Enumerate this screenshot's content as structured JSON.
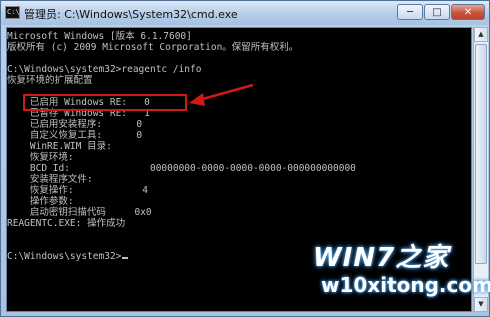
{
  "window": {
    "title": "管理员: C:\\Windows\\System32\\cmd.exe",
    "icon_text": "C:\\",
    "controls": {
      "minimize": "─",
      "maximize": "□",
      "close": "✕"
    }
  },
  "console": {
    "lines": [
      "Microsoft Windows [版本 6.1.7600]",
      "版权所有 (c) 2009 Microsoft Corporation。保留所有权利。",
      "",
      "C:\\Windows\\system32>reagentc /info",
      "恢复环境的扩展配置",
      "",
      "    已启用 Windows RE:   0",
      "    已暂存 Windows RE:   1",
      "    已启用安装程序:      0",
      "    自定义恢复工具:      0",
      "    WinRE.WIM 目录:",
      "    恢复环境:",
      "    BCD Id:              00000000-0000-0000-0000-000000000000",
      "    安装程序文件:",
      "    恢复操作:            4",
      "    操作参数:",
      "    启动密钥扫描代码     0x0",
      "REAGENTC.EXE: 操作成功",
      "",
      "",
      "C:\\Windows\\system32>"
    ]
  },
  "annotation": {
    "highlight_color": "#d01818"
  },
  "watermark": {
    "logo": "WIN7之家",
    "site": "w10xitong.com"
  },
  "colors": {
    "console_bg": "#000000",
    "console_text": "#c0c0c0",
    "titlebar": "#b5cde8"
  }
}
